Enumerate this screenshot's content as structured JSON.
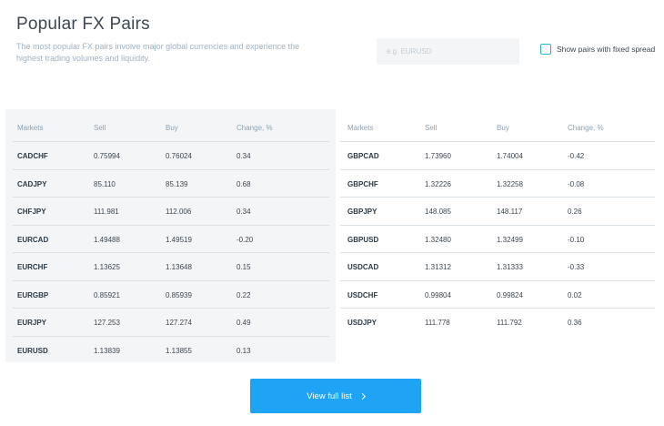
{
  "header": {
    "title": "Popular FX Pairs",
    "description": "The most popular FX pairs involve major global currencies and experience the highest trading volumes and liquidity."
  },
  "search": {
    "placeholder": "e.g. EURUSD",
    "value": ""
  },
  "fixed_spread": {
    "label": "Show pairs with fixed spread",
    "checked": false
  },
  "columns": [
    "Markets",
    "Sell",
    "Buy",
    "Change, %"
  ],
  "left_table": [
    [
      "CADCHF",
      "0.75994",
      "0.76024",
      "0.34"
    ],
    [
      "CADJPY",
      "85.110",
      "85.139",
      "0.68"
    ],
    [
      "CHFJPY",
      "111.981",
      "112.006",
      "0.34"
    ],
    [
      "EURCAD",
      "1.49488",
      "1.49519",
      "-0.20"
    ],
    [
      "EURCHF",
      "1.13625",
      "1.13648",
      "0.15"
    ],
    [
      "EURGBP",
      "0.85921",
      "0.85939",
      "0.22"
    ],
    [
      "EURJPY",
      "127.253",
      "127.274",
      "0.49"
    ],
    [
      "EURUSD",
      "1.13839",
      "1.13855",
      "0.13"
    ]
  ],
  "right_table": [
    [
      "GBPCAD",
      "1.73960",
      "1.74004",
      "-0.42"
    ],
    [
      "GBPCHF",
      "1.32226",
      "1.32258",
      "-0.08"
    ],
    [
      "GBPJPY",
      "148.085",
      "148.117",
      "0.26"
    ],
    [
      "GBPUSD",
      "1.32480",
      "1.32499",
      "-0.10"
    ],
    [
      "USDCAD",
      "1.31312",
      "1.31333",
      "-0.33"
    ],
    [
      "USDCHF",
      "0.99804",
      "0.99824",
      "0.02"
    ],
    [
      "USDJPY",
      "111.778",
      "111.792",
      "0.36"
    ]
  ],
  "footer": {
    "button_label": "View full list",
    "button_icon": "chevron-right-icon"
  },
  "colors": {
    "accent": "#1fa3f4",
    "checkbox": "#2bb5cf",
    "table_bg": "#f3f5f7",
    "muted_text": "#9fb2c3"
  }
}
